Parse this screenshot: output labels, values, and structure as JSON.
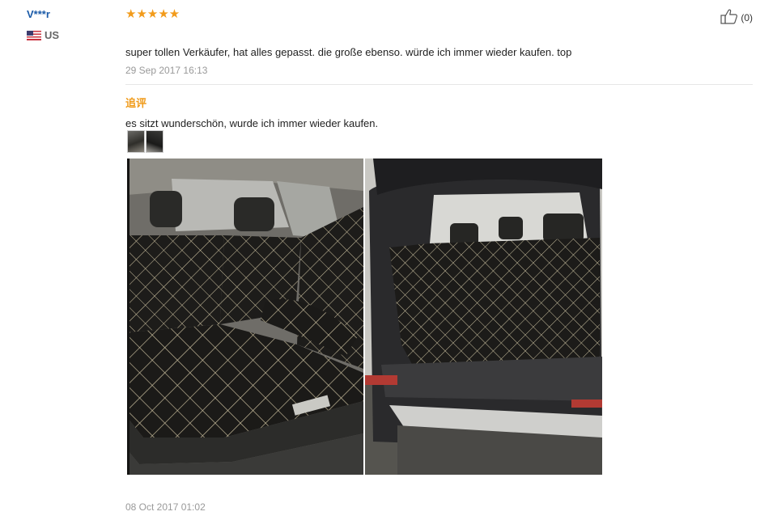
{
  "reviewer": {
    "name": "V***r",
    "country": "US"
  },
  "review": {
    "rating": 5,
    "stars": "★★★★★",
    "text": "super tollen Verkäufer, hat alles gepasst. die große ebenso. würde ich immer wieder kaufen. top",
    "date": "29 Sep 2017 16:13",
    "helpful_count": "(0)"
  },
  "followup": {
    "label": "追评",
    "text": "es sitzt wunderschön, wurde ich immer wieder kaufen.",
    "date": "08 Oct 2017 01:02"
  },
  "colors": {
    "star": "#f29b1b",
    "followup_label": "#f09b1a",
    "reviewer_name": "#1a5aa8",
    "date_text": "#999999",
    "divider": "#e6e6e6"
  },
  "icons": {
    "helpful": "thumbs-up-icon",
    "country": "us-flag-icon"
  }
}
